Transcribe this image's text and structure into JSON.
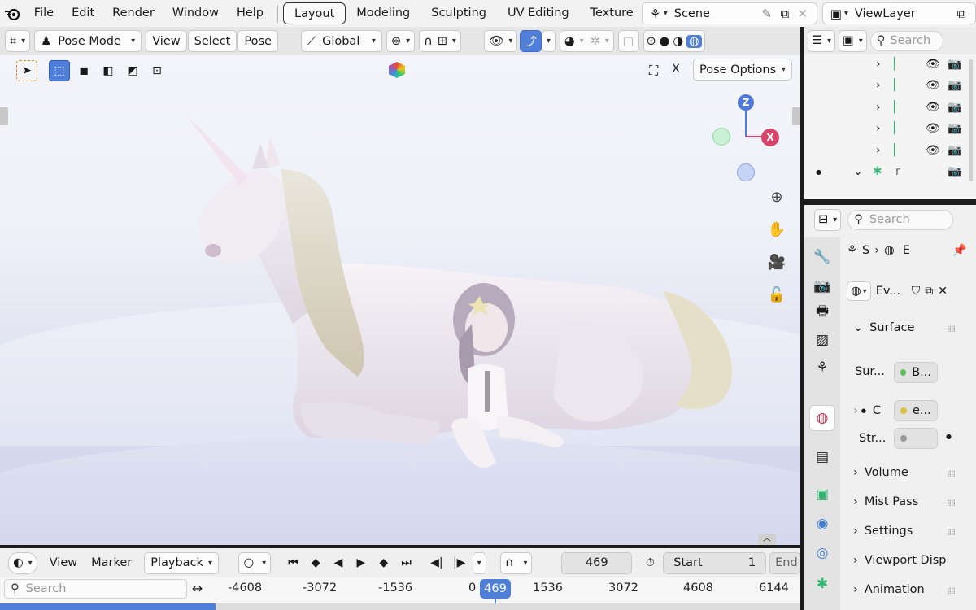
{
  "menu": [
    "File",
    "Edit",
    "Render",
    "Window",
    "Help"
  ],
  "workspaces": [
    {
      "label": "Layout",
      "active": true
    },
    {
      "label": "Modeling",
      "active": false
    },
    {
      "label": "Sculpting",
      "active": false
    },
    {
      "label": "UV Editing",
      "active": false
    },
    {
      "label": "Texture",
      "active": false
    }
  ],
  "scene": {
    "name": "Scene"
  },
  "view_layer": {
    "name": "ViewLayer"
  },
  "viewport_header": {
    "mode": "Pose Mode",
    "view": "View",
    "select": "Select",
    "pose": "Pose",
    "orientation": "Global"
  },
  "viewport": {
    "x_toggle": "X",
    "pose_options": "Pose Options",
    "gizmo_z": "Z",
    "gizmo_x": "X"
  },
  "outliner": {
    "search_placeholder": "Search",
    "last_row_label": "r"
  },
  "properties": {
    "search_placeholder": "Search",
    "breadcrumb_scene": "S",
    "breadcrumb_world": "E",
    "world_name": "Ev...",
    "sections": {
      "surface": "Surface",
      "volume": "Volume",
      "mist": "Mist Pass",
      "settings": "Settings",
      "viewport_display": "Viewport Disp",
      "animation": "Animation"
    },
    "surface_label": "Sur...",
    "surface_value": "B...",
    "color_label": "C",
    "color_value": "e...",
    "strength_label": "Str..."
  },
  "timeline": {
    "view": "View",
    "marker": "Marker",
    "playback": "Playback",
    "current_frame": "469",
    "start_label": "Start",
    "start_value": "1",
    "end_label": "End",
    "search_placeholder": "Search",
    "ticks": [
      "-4608",
      "-3072",
      "-1536",
      "0",
      "1536",
      "3072",
      "4608",
      "6144"
    ],
    "playhead": "469"
  },
  "colors": {
    "accent": "#4f7fd9",
    "gizmo_z": "#4f79d8",
    "gizmo_x": "#d7456b",
    "gizmo_y": "#8fd9a4",
    "surface_dot": "#5cbf5c",
    "color_dot": "#d9c43d"
  }
}
